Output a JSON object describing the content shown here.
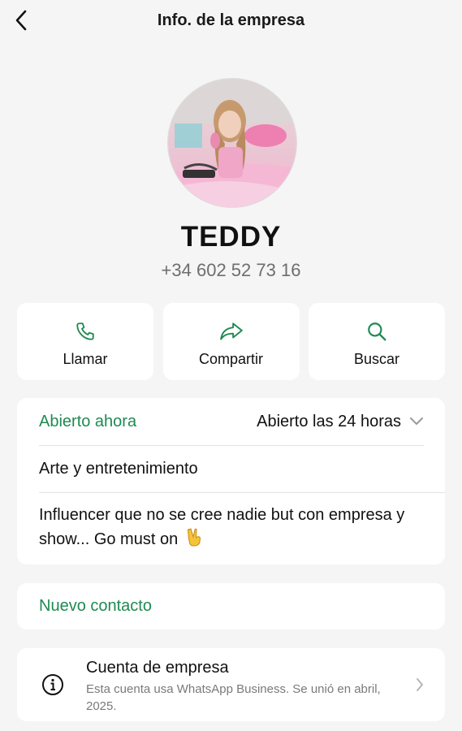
{
  "header": {
    "title": "Info. de la empresa",
    "back_icon": "chevron-left-icon"
  },
  "profile": {
    "name": "TEDDY",
    "phone": "+34 602 52 73 16"
  },
  "actions": [
    {
      "label": "Llamar",
      "icon": "phone-icon"
    },
    {
      "label": "Compartir",
      "icon": "share-arrow-icon"
    },
    {
      "label": "Buscar",
      "icon": "search-icon"
    }
  ],
  "info": {
    "status": "Abierto ahora",
    "hours": "Abierto las 24 horas",
    "category": "Arte y entretenimiento",
    "description": "Influencer que no se cree nadie but con empresa y show... Go must on",
    "description_emoji": "victory-hand-icon"
  },
  "contact": {
    "label": "Nuevo contacto"
  },
  "business": {
    "title": "Cuenta de empresa",
    "subtitle": "Esta cuenta usa WhatsApp Business. Se unió en abril, 2025.",
    "icon": "info-circle-icon"
  },
  "colors": {
    "accent_green": "#1f8a52",
    "background": "#f5f5f5",
    "card": "#ffffff",
    "muted": "#6e6e6e"
  }
}
